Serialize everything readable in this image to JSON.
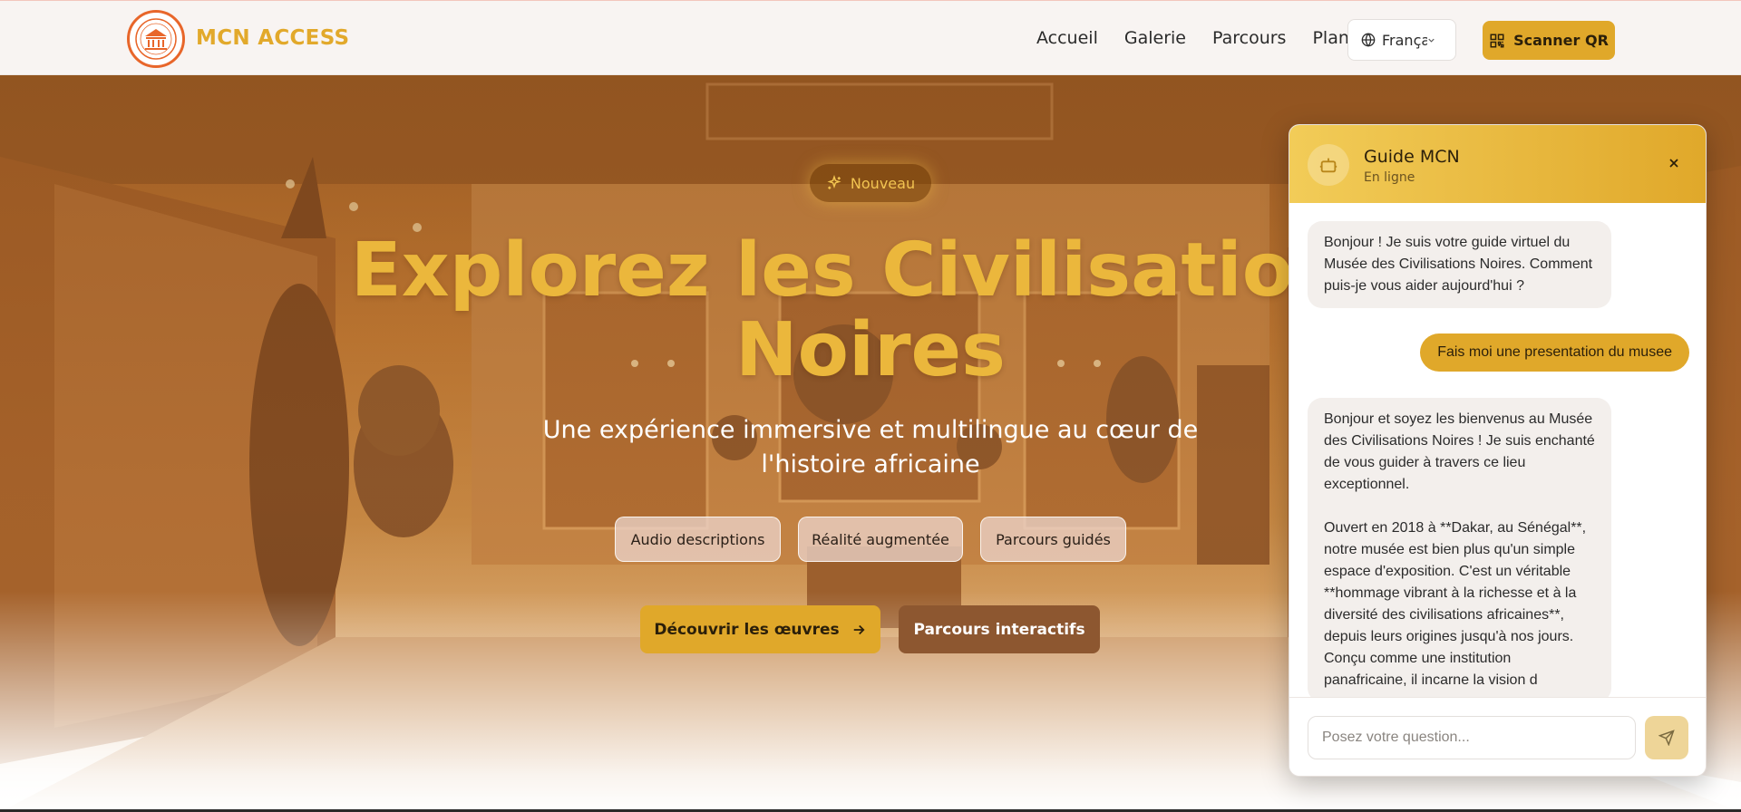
{
  "header": {
    "brand": "MCN ACCESS",
    "nav": [
      "Accueil",
      "Galerie",
      "Parcours",
      "Plan"
    ],
    "language": "Françai",
    "scan_label": "Scanner QR"
  },
  "hero": {
    "badge": "Nouveau",
    "title_line1": "Explorez les Civilisations",
    "title_line2": "Noires",
    "subtitle": "Une expérience immersive et multilingue au cœur de l'histoire africaine",
    "features": [
      "Audio descriptions",
      "Réalité augmentée",
      "Parcours guidés"
    ],
    "cta_primary": "Découvrir les œuvres",
    "cta_secondary": "Parcours interactifs"
  },
  "chat": {
    "title": "Guide MCN",
    "status": "En ligne",
    "messages": [
      {
        "role": "bot",
        "text": "Bonjour ! Je suis votre guide virtuel du Musée des Civilisations Noires. Comment puis-je vous aider aujourd'hui ?"
      },
      {
        "role": "user",
        "text": "Fais moi une presentation du musee"
      },
      {
        "role": "bot",
        "text": "Bonjour et soyez les bienvenus au Musée des Civilisations Noires ! Je suis enchanté de vous guider à travers ce lieu exceptionnel.\n\nOuvert en 2018 à **Dakar, au Sénégal**, notre musée est bien plus qu'un simple espace d'exposition. C'est un véritable **hommage vibrant à la richesse et à la diversité des civilisations africaines**, depuis leurs origines jusqu'à nos jours. Conçu comme une institution panafricaine, il incarne la vision d"
      }
    ],
    "input_placeholder": "Posez votre question..."
  },
  "colors": {
    "accent": "#e0a82a",
    "brand_text": "#e2a92b",
    "secondary_button": "#8d5730",
    "header_bg": "#f8f4f2"
  },
  "icons": {
    "logo": "museum-seal-logo",
    "language": "globe-icon",
    "language_caret": "chevron-down-icon",
    "scan": "qr-code-icon",
    "badge": "sparkles-icon",
    "cta": "arrow-right-icon",
    "bot": "bot-icon",
    "close": "close-icon",
    "send": "send-icon"
  }
}
